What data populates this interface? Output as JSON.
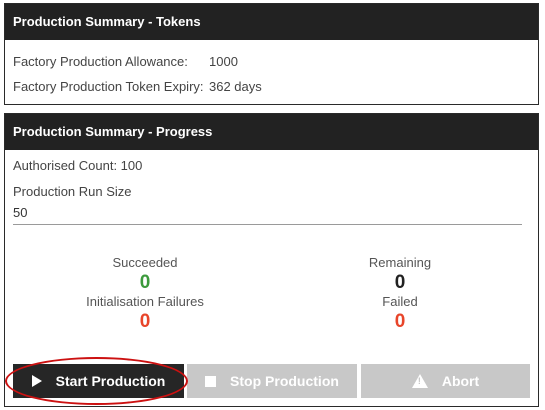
{
  "tokens": {
    "title": "Production Summary - Tokens",
    "allowance_label": "Factory Production Allowance:",
    "allowance_value": "1000",
    "expiry_label": "Factory Production Token Expiry:",
    "expiry_value": "362 days"
  },
  "progress": {
    "title": "Production Summary - Progress",
    "authorised_count": "Authorised Count: 100",
    "run_size_label": "Production Run Size",
    "run_size_value": "50",
    "succeeded_label": "Succeeded",
    "succeeded_value": "0",
    "remaining_label": "Remaining",
    "remaining_value": "0",
    "init_failures_label": "Initialisation Failures",
    "init_failures_value": "0",
    "failed_label": "Failed",
    "failed_value": "0"
  },
  "buttons": {
    "start": "Start Production",
    "stop": "Stop Production",
    "abort": "Abort"
  },
  "colors": {
    "header_bg": "#222222",
    "succeeded": "#3c9a3c",
    "failure": "#e8452a",
    "disabled_button": "#c8c8c8",
    "highlight": "#cc1111"
  },
  "icons": {
    "start": "play-icon",
    "stop": "stop-icon",
    "abort": "warning-icon"
  }
}
